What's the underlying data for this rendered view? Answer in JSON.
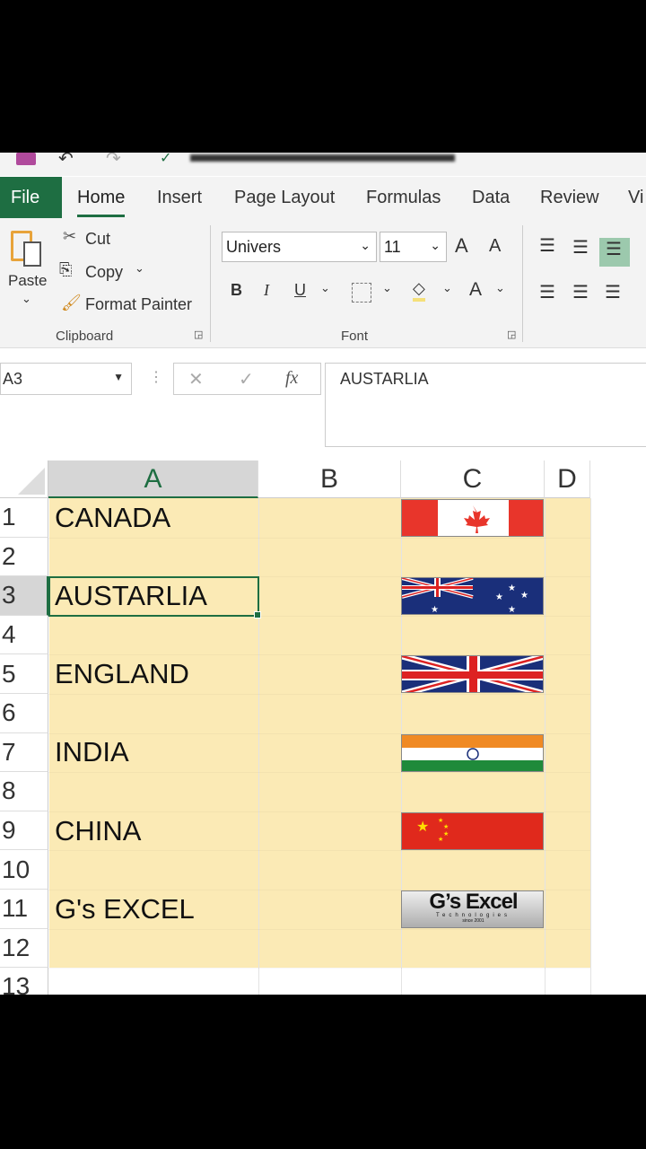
{
  "ribbon": {
    "tabs": [
      "File",
      "Home",
      "Insert",
      "Page Layout",
      "Formulas",
      "Data",
      "Review",
      "Vi"
    ],
    "paste": "Paste",
    "cut": "Cut",
    "copy": "Copy",
    "format_painter": "Format Painter",
    "clipboard": "Clipboard",
    "font_name": "Univers",
    "font_size": "11",
    "font_group": "Font",
    "bold": "B",
    "italic": "I",
    "underline": "U",
    "font_color": "A",
    "grow": "A",
    "shrink": "A"
  },
  "formula_bar": {
    "name_box": "A3",
    "fx": "fx",
    "formula": "AUSTARLIA"
  },
  "sheet": {
    "columns": [
      "A",
      "B",
      "C",
      "D"
    ],
    "rows": [
      "1",
      "2",
      "3",
      "4",
      "5",
      "6",
      "7",
      "8",
      "9",
      "10",
      "11",
      "12",
      "13"
    ],
    "cells": [
      {
        "row": 1,
        "text": "CANADA",
        "flag": "canada"
      },
      {
        "row": 3,
        "text": "AUSTARLIA",
        "flag": "australia"
      },
      {
        "row": 5,
        "text": "ENGLAND",
        "flag": "uk"
      },
      {
        "row": 7,
        "text": "INDIA",
        "flag": "india"
      },
      {
        "row": 9,
        "text": "CHINA",
        "flag": "china"
      },
      {
        "row": 11,
        "text": "G's EXCEL",
        "flag": "logo"
      }
    ],
    "logo": {
      "title": "G’s Excel",
      "sub": "Technologies",
      "since": "since 2001"
    },
    "selected": "A3"
  }
}
